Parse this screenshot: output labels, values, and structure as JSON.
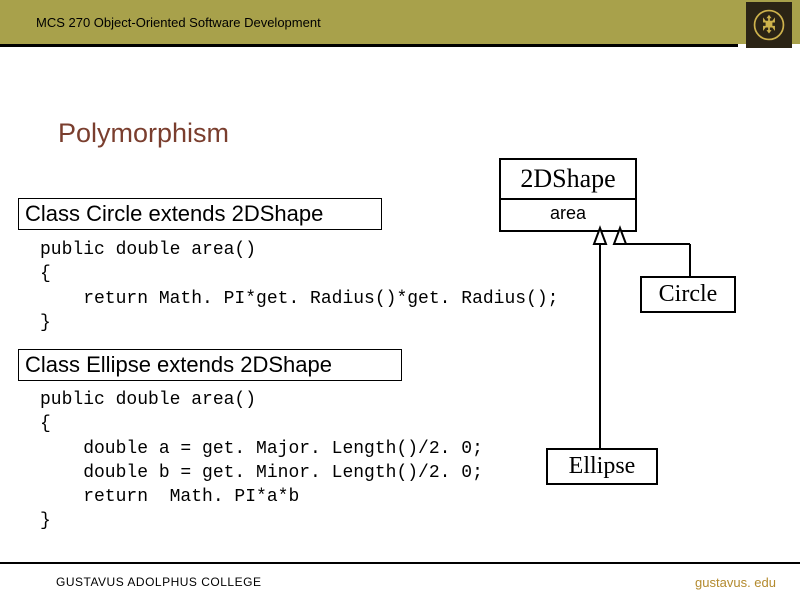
{
  "header": {
    "course": "MCS 270 Object-Oriented Software Development"
  },
  "title": "Polymorphism",
  "class_decl_1": "Class Circle extends 2DShape",
  "code_1": "public double area()\n{\n    return Math. PI*get. Radius()*get. Radius();\n}",
  "class_decl_2": "Class Ellipse extends 2DShape",
  "code_2": "public double area()\n{\n    double a = get. Major. Length()/2. 0;\n    double b = get. Minor. Length()/2. 0;\n    return  Math. PI*a*b\n}",
  "uml": {
    "super_name": "2DShape",
    "super_attr": "area",
    "child1": "Circle",
    "child2": "Ellipse"
  },
  "footer": {
    "college": "GUSTAVUS ADOLPHUS COLLEGE",
    "site": "gustavus. edu"
  }
}
